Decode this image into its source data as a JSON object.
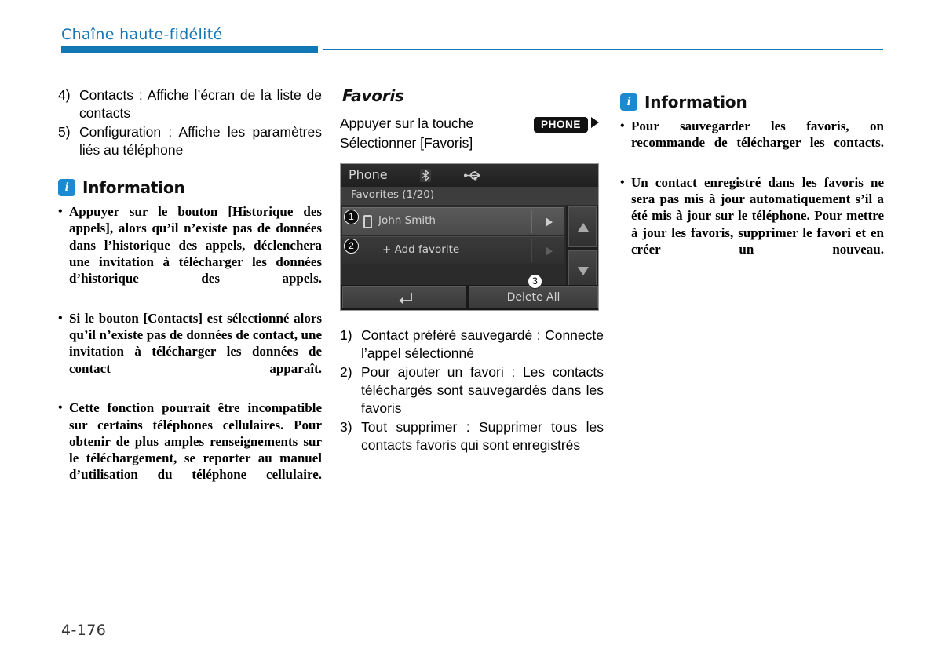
{
  "header": {
    "title": "Chaîne haute-fidélité",
    "accent_color": "#1278b4"
  },
  "footer": {
    "page_number": "4-176"
  },
  "left_column": {
    "numbered_items": [
      {
        "marker": "4)",
        "text": "Contacts : Affiche l’écran de la liste de contacts"
      },
      {
        "marker": "5)",
        "text": "Configuration : Affiche les paramètres liés au téléphone"
      }
    ],
    "info": {
      "icon": "info-icon",
      "icon_letter": "i",
      "title": "Information",
      "bullets": [
        "Appuyer sur le bouton [Historique des appels], alors qu’il n’existe pas de données dans l’historique des appels, déclenchera une invitation à télécharger les données d’historique des appels.",
        "Si le bouton [Contacts] est sélectionné alors qu’il n’existe pas de données de contact, une invitation à télécharger les données de contact apparaît.",
        "Cette fonction pourrait être incompatible sur certains téléphones cellulaires. Pour obtenir de plus amples renseignements sur le téléchargement, se reporter au manuel d’utilisation du téléphone cellulaire."
      ]
    }
  },
  "middle_column": {
    "section_title": "Favoris",
    "instruction": {
      "prefix": "Appuyer sur la touche",
      "key_label": "PHONE",
      "arrow_icon": "triangle-right-icon",
      "next_line": "Sélectionner [Favoris]"
    },
    "device_screen": {
      "title": "Phone",
      "bluetooth_icon": "bluetooth-icon",
      "usb_icon": "usb-icon",
      "subtitle": "Favorites (1/20)",
      "rows": [
        {
          "callout": "1",
          "icon": "mobile-phone-icon",
          "label": "John Smith",
          "arrow": "triangle-right-icon"
        },
        {
          "callout": "2",
          "icon": "plus-icon",
          "label": "+ Add favorite",
          "arrow": "triangle-right-icon"
        }
      ],
      "scroll_up_icon": "triangle-up-icon",
      "scroll_down_icon": "triangle-down-icon",
      "back_button_icon": "return-arrow-icon",
      "delete_all_label": "Delete All",
      "delete_all_callout": "3"
    },
    "numbered_items": [
      {
        "marker": "1)",
        "text": "Contact préféré sauvegardé : Connecte l’appel sélectionné"
      },
      {
        "marker": "2)",
        "text": "Pour ajouter un favori : Les contacts téléchargés sont sauvegardés dans les favoris"
      },
      {
        "marker": "3)",
        "text": "Tout supprimer : Supprimer tous les contacts favoris qui sont enregistrés"
      }
    ]
  },
  "right_column": {
    "info": {
      "icon": "info-icon",
      "icon_letter": "i",
      "title": "Information",
      "bullets": [
        "Pour sauvegarder les favoris, on recommande de télécharger les contacts.",
        "Un contact enregistré dans les favoris ne sera pas mis à jour automatiquement s’il a été mis à jour sur le téléphone. Pour mettre à jour les favoris, supprimer le favori et en créer un nouveau."
      ]
    }
  }
}
